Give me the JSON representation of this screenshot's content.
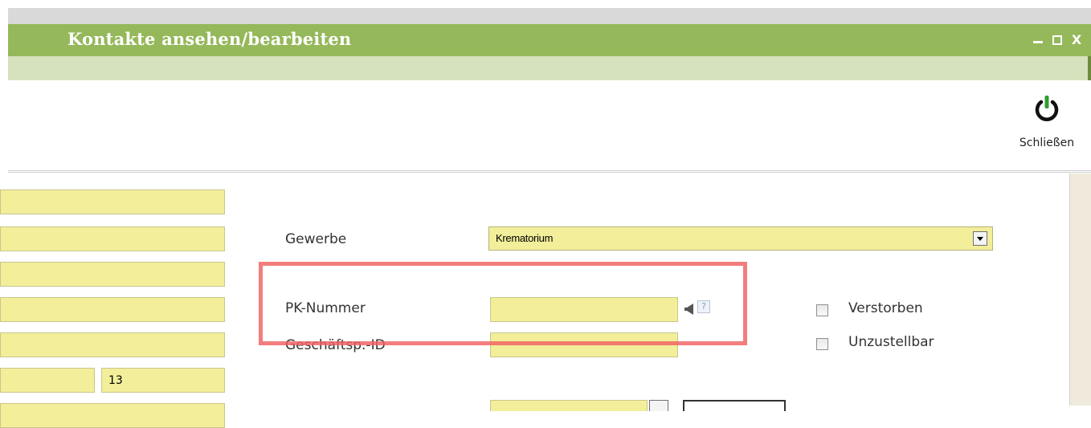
{
  "window": {
    "title": "Kontakte ansehen/bearbeiten",
    "controls": {
      "minimize": "_",
      "maximize": "□",
      "close": "X"
    }
  },
  "toolbar": {
    "close_label": "Schließen",
    "close_icon": "power-icon"
  },
  "form": {
    "left_fields": [
      "",
      "",
      "",
      "",
      "",
      "",
      "13",
      ""
    ],
    "gewerbe": {
      "label": "Gewerbe",
      "value": "Krematorium"
    },
    "pk_nummer": {
      "label": "PK-Nummer",
      "value": "",
      "help": "?"
    },
    "geschaeftsp_id": {
      "label": "Geschäftsp.-ID",
      "value": ""
    },
    "checkboxes": [
      {
        "label": "Verstorben",
        "checked": false
      },
      {
        "label": "Unzustellbar",
        "checked": false
      }
    ]
  },
  "colors": {
    "titlebar": "#95b85a",
    "subbar": "#d5e2bd",
    "field": "#f2ee9a",
    "highlight": "#f06060"
  }
}
